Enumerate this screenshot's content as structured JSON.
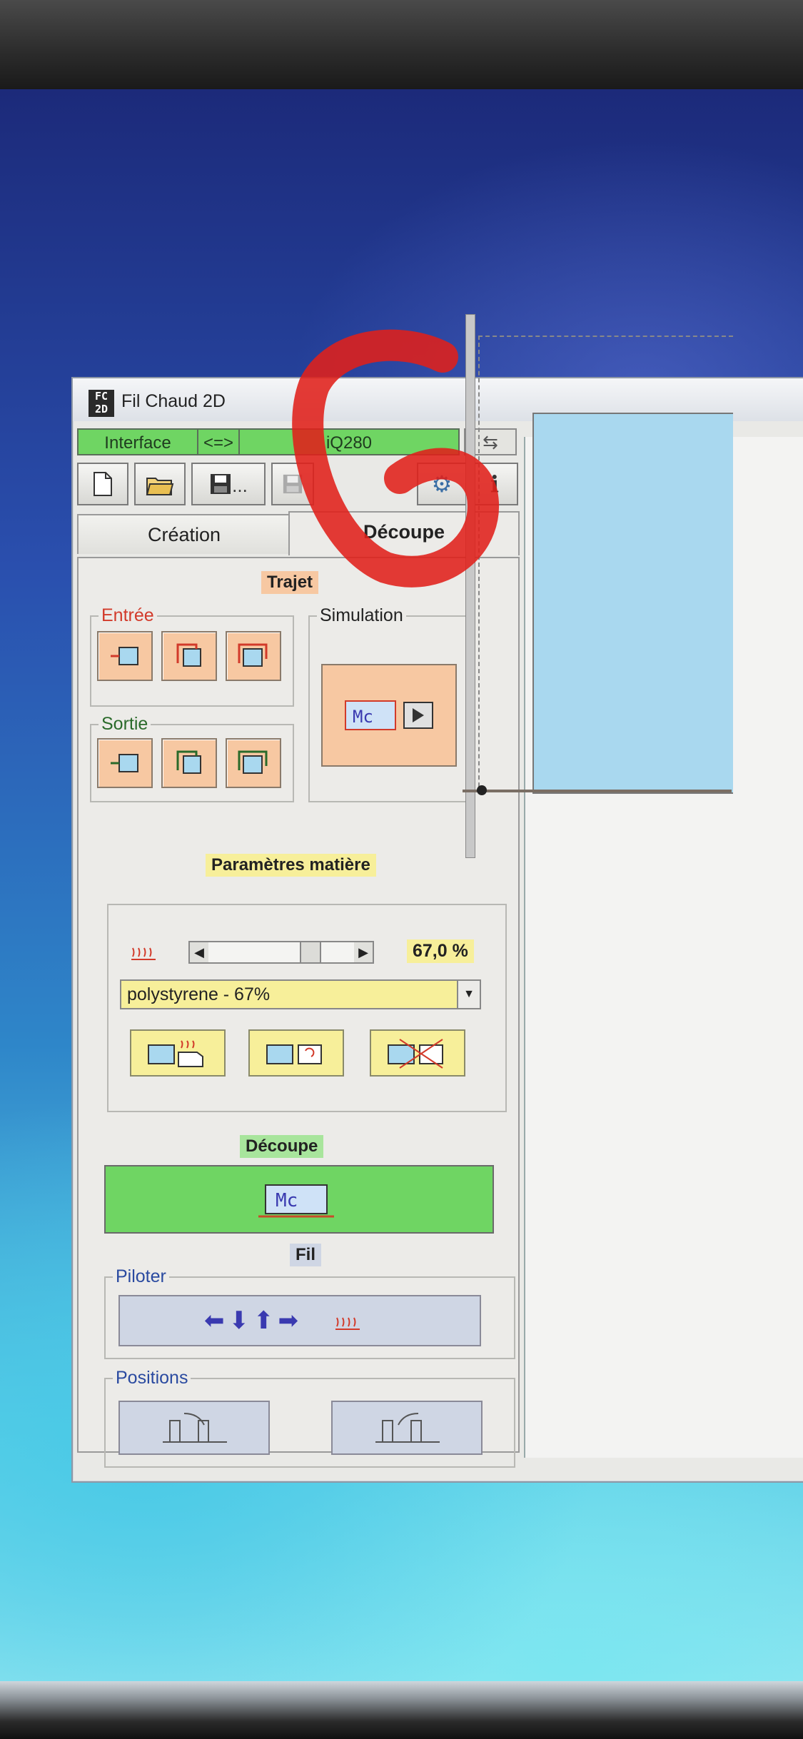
{
  "window": {
    "title": "Fil Chaud 2D",
    "logo": "FC 2D"
  },
  "status_bar": {
    "interface_label": "Interface",
    "link_label": "<=>",
    "machine_label": "iQ280",
    "usb_icon": "usb-icon"
  },
  "toolbar": {
    "new_icon": "new-file-icon",
    "open_icon": "open-folder-icon",
    "save_as_icon": "save-as-icon",
    "save_as_dots": "...",
    "save_icon": "save-icon",
    "settings_icon": "gear-icon",
    "info_icon": "info-icon"
  },
  "tabs": [
    {
      "label": "Création",
      "active": false
    },
    {
      "label": "Découpe",
      "active": true
    }
  ],
  "trajet": {
    "title": "Trajet",
    "entree_label": "Entrée",
    "sortie_label": "Sortie",
    "simulation_label": "Simulation"
  },
  "materiau": {
    "title": "Paramètres matière",
    "percent": "67,0 %",
    "slider_level": 0.67,
    "selected": "polystyrene - 67%"
  },
  "decoupe": {
    "title": "Découpe"
  },
  "fil": {
    "title": "Fil",
    "piloter_label": "Piloter",
    "arrows": "⬅⬇⬆➡",
    "positions_label": "Positions"
  },
  "colors": {
    "green": "#6fd563",
    "orange": "#f7c8a2",
    "yellow": "#f7ef9a",
    "blue_button": "#cfd6e4",
    "block": "#a9d8ef"
  }
}
